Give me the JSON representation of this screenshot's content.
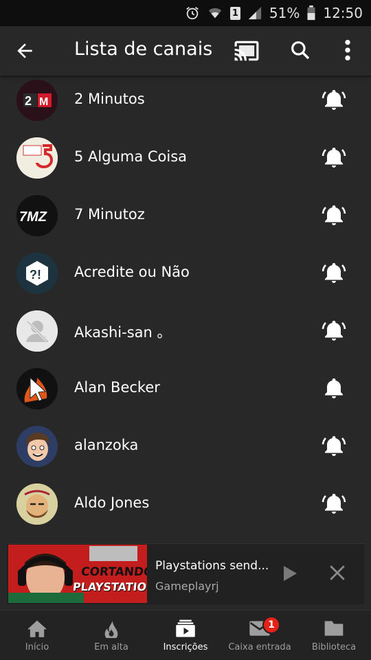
{
  "status": {
    "battery": "51%",
    "time": "12:50",
    "sim": "1"
  },
  "header": {
    "title": "Lista de canais"
  },
  "channels": [
    {
      "name": "2 Minutos",
      "bell": "all"
    },
    {
      "name": "5 Alguma Coisa",
      "bell": "all"
    },
    {
      "name": "7 Minutoz",
      "bell": "all"
    },
    {
      "name": "Acredite ou Não",
      "bell": "all"
    },
    {
      "name": "Akashi-san 。",
      "bell": "all"
    },
    {
      "name": "Alan Becker",
      "bell": "personalized"
    },
    {
      "name": "alanzoka",
      "bell": "all"
    },
    {
      "name": "Aldo Jones",
      "bell": "all"
    }
  ],
  "miniplayer": {
    "title": "Playstations send...",
    "channel": "Gameplayrj",
    "thumb_line1": "CORTANDO",
    "thumb_line2": "PLAYSTATIONS"
  },
  "nav": [
    {
      "label": "Início"
    },
    {
      "label": "Em alta"
    },
    {
      "label": "Inscrições"
    },
    {
      "label": "Caixa entrada",
      "badge": "1"
    },
    {
      "label": "Biblioteca"
    }
  ],
  "colors": {
    "background": "#282828",
    "badge": "#e62117",
    "thumb": "#c41d1d"
  }
}
